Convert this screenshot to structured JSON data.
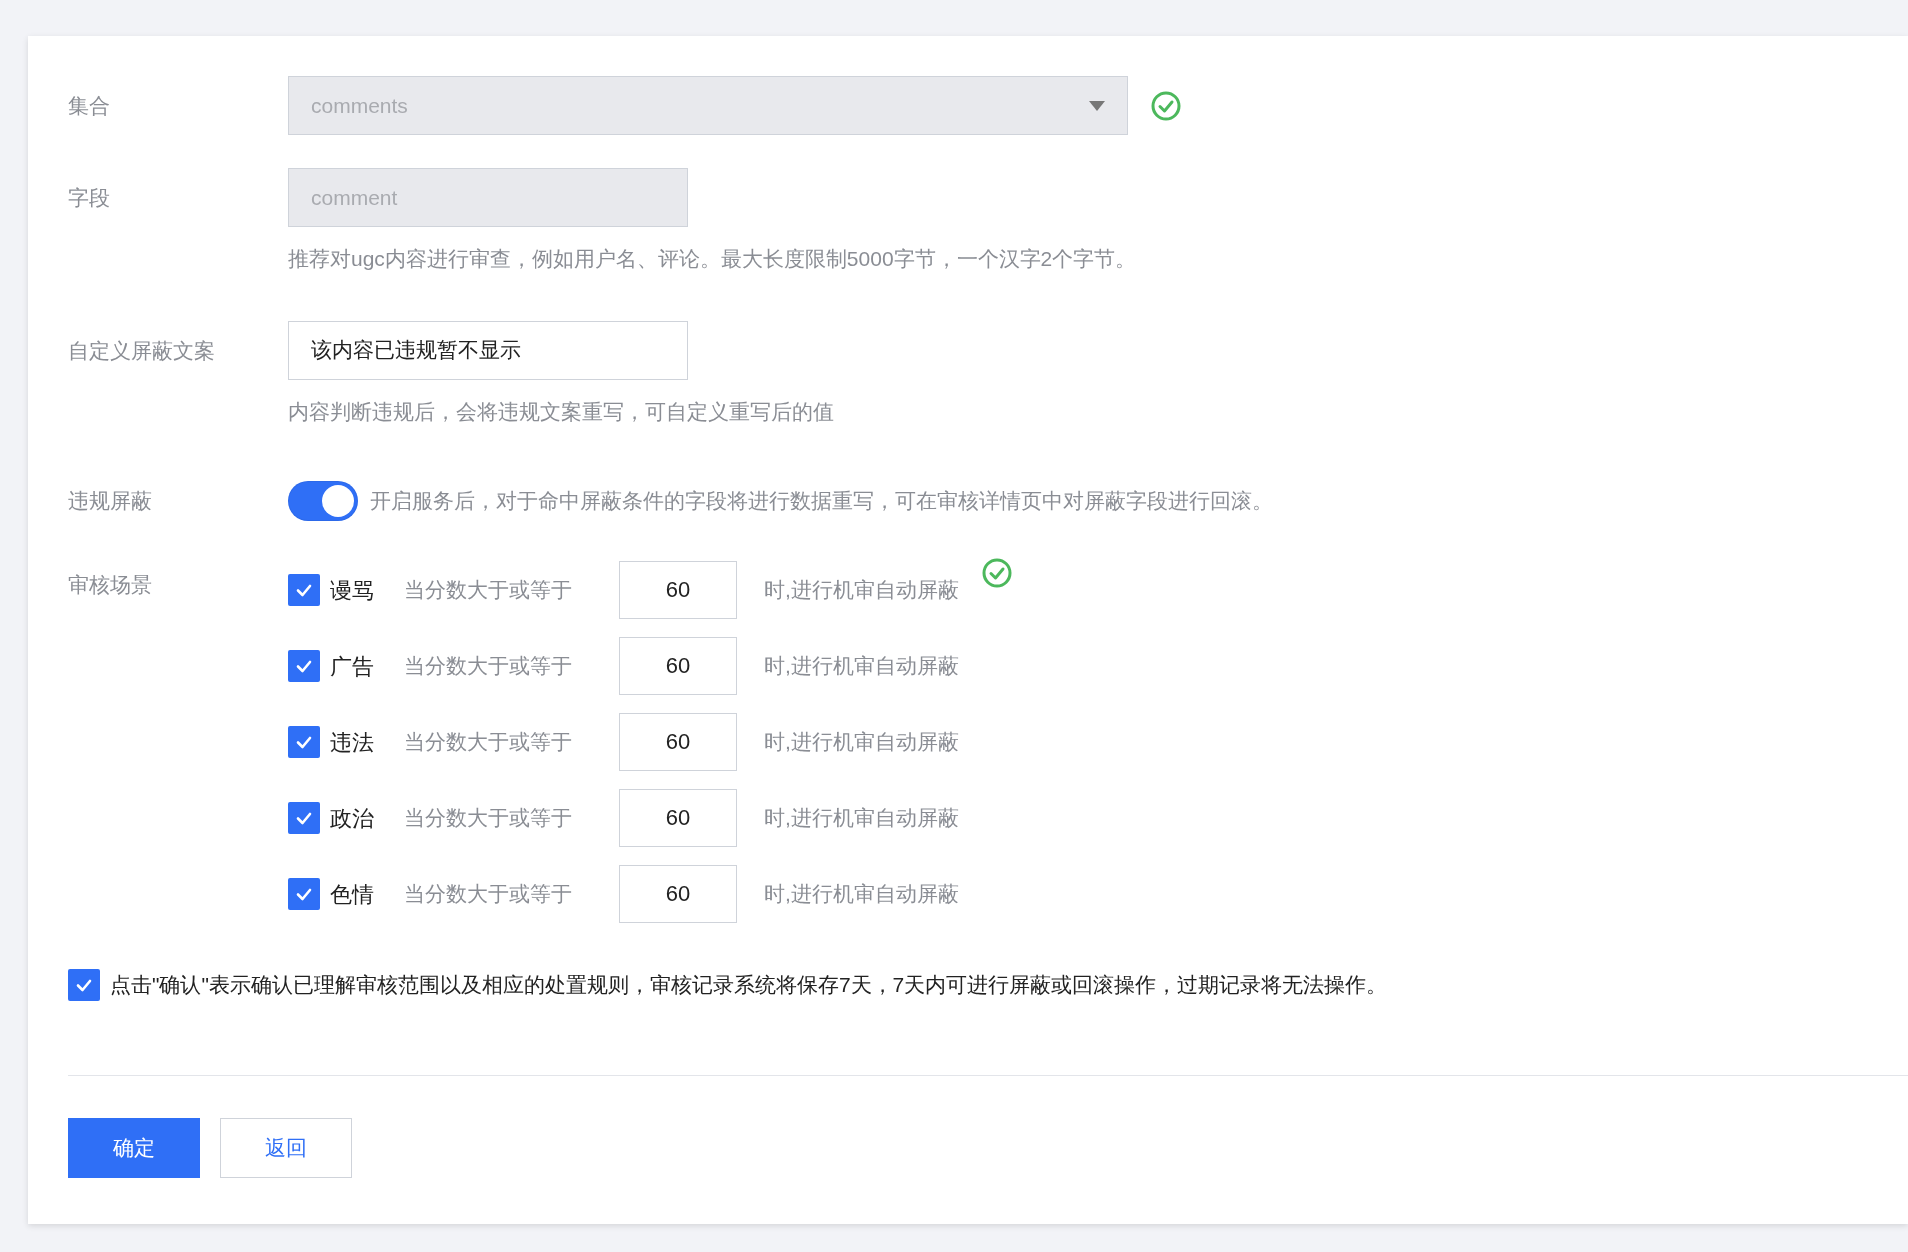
{
  "form": {
    "collection": {
      "label": "集合",
      "value": "comments",
      "disabled": true,
      "valid": true
    },
    "field": {
      "label": "字段",
      "value": "comment",
      "disabled": true,
      "hint": "推荐对ugc内容进行审查，例如用户名、评论。最大长度限制5000字节，一个汉字2个字节。"
    },
    "custom_text": {
      "label": "自定义屏蔽文案",
      "value": "该内容已违规暂不显示",
      "disabled": false,
      "hint": "内容判断违规后，会将违规文案重写，可自定义重写后的值"
    },
    "block": {
      "label": "违规屏蔽",
      "on": true,
      "description": "开启服务后，对于命中屏蔽条件的字段将进行数据重写，可在审核详情页中对屏蔽字段进行回滚。"
    },
    "scenes": {
      "label": "审核场景",
      "valid": true,
      "items": [
        {
          "name": "谩骂",
          "checked": true,
          "prefix": "当分数大于或等于",
          "value": "60",
          "suffix": "时,进行机审自动屏蔽"
        },
        {
          "name": "广告",
          "checked": true,
          "prefix": "当分数大于或等于",
          "value": "60",
          "suffix": "时,进行机审自动屏蔽"
        },
        {
          "name": "违法",
          "checked": true,
          "prefix": "当分数大于或等于",
          "value": "60",
          "suffix": "时,进行机审自动屏蔽"
        },
        {
          "name": "政治",
          "checked": true,
          "prefix": "当分数大于或等于",
          "value": "60",
          "suffix": "时,进行机审自动屏蔽"
        },
        {
          "name": "色情",
          "checked": true,
          "prefix": "当分数大于或等于",
          "value": "60",
          "suffix": "时,进行机审自动屏蔽"
        }
      ]
    },
    "agreement": {
      "checked": true,
      "text": "点击\"确认\"表示确认已理解审核范围以及相应的处置规则，审核记录系统将保存7天，7天内可进行屏蔽或回滚操作，过期记录将无法操作。"
    }
  },
  "buttons": [
    {
      "label": "确定",
      "kind": "primary"
    },
    {
      "label": "返回",
      "kind": "secondary"
    }
  ]
}
